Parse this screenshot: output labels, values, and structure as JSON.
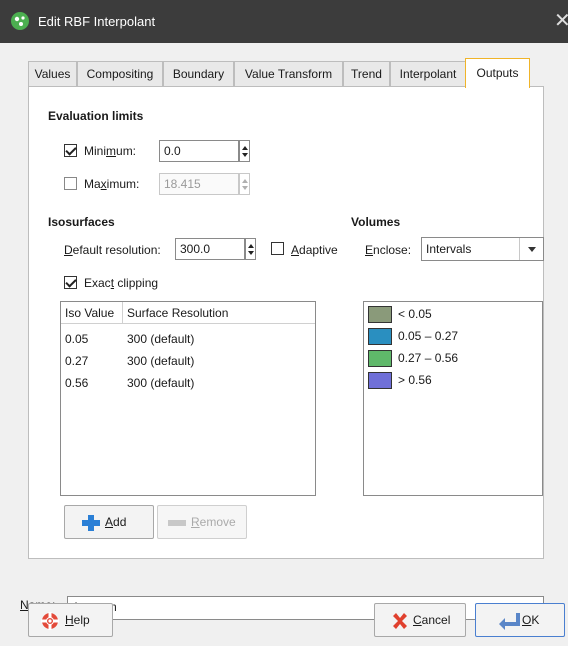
{
  "window": {
    "title": "Edit RBF Interpolant"
  },
  "tabs": [
    {
      "label": "Values"
    },
    {
      "label": "Compositing"
    },
    {
      "label": "Boundary"
    },
    {
      "label": "Value Transform"
    },
    {
      "label": "Trend"
    },
    {
      "label": "Interpolant"
    },
    {
      "label": "Outputs"
    }
  ],
  "active_tab": "Outputs",
  "evaluation_limits": {
    "title": "Evaluation limits",
    "minimum": {
      "label_pre": "Mini",
      "label_u": "m",
      "label_post": "um:",
      "checked": true,
      "value": "0.0"
    },
    "maximum": {
      "label_pre": "Ma",
      "label_u": "x",
      "label_post": "imum:",
      "checked": false,
      "value": "18.415"
    }
  },
  "isosurfaces": {
    "title": "Isosurfaces",
    "default_resolution": {
      "label_u": "D",
      "label_post": "efault resolution:",
      "value": "300.0"
    },
    "adaptive": {
      "label_u": "A",
      "label_post": "daptive",
      "checked": false
    },
    "exact_clipping": {
      "label_pre": "Exac",
      "label_u": "t",
      "label_post": " clipping",
      "checked": true
    },
    "columns": [
      "Iso Value",
      "Surface Resolution"
    ],
    "rows": [
      {
        "iso": "0.05",
        "resolution": "300 (default)"
      },
      {
        "iso": "0.27",
        "resolution": "300 (default)"
      },
      {
        "iso": "0.56",
        "resolution": "300 (default)"
      }
    ],
    "add_button": {
      "label_u": "A",
      "label_post": "dd"
    },
    "remove_button": {
      "label_u": "R",
      "label_post": "emove"
    }
  },
  "volumes": {
    "title": "Volumes",
    "enclose": {
      "label_u": "E",
      "label_post": "nclose:",
      "value": "Intervals"
    },
    "items": [
      {
        "label": "< 0.05",
        "color": "#8a9a7a"
      },
      {
        "label": "0.05 – 0.27",
        "color": "#2a8fc0"
      },
      {
        "label": "0.27 – 0.56",
        "color": "#5fb86a"
      },
      {
        "label": "> 0.56",
        "color": "#6f6fd8"
      }
    ]
  },
  "name": {
    "label_u": "N",
    "label_post": "ame:",
    "value": "Au_ppm"
  },
  "footer": {
    "help": {
      "label_u": "H",
      "label_post": "elp"
    },
    "cancel": {
      "label_u": "C",
      "label_post": "ancel"
    },
    "ok": {
      "label_u": "O",
      "label_post": "K"
    }
  }
}
